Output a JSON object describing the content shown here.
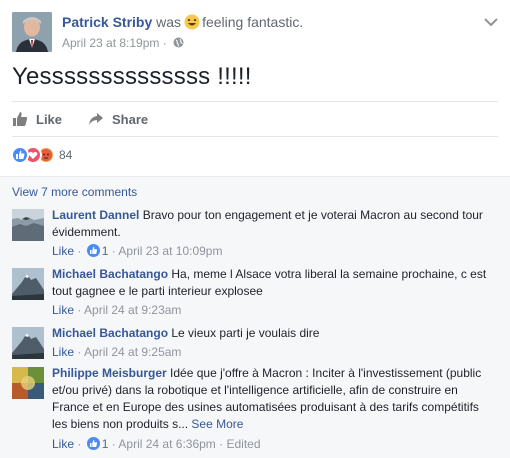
{
  "post": {
    "author": "Patrick Striby",
    "was": "was",
    "feeling": "feeling fantastic.",
    "date": "April 23 at 8:19pm",
    "dot": "·",
    "text": "Yessssssssssssss !!!!!"
  },
  "actions": {
    "like": "Like",
    "share": "Share"
  },
  "reactions": {
    "count": "84"
  },
  "view_more": "View 7 more comments",
  "comments": [
    {
      "name": "Laurent Dannel",
      "text": "Bravo pour ton engagement et je voterai Macron au second tour évidemment.",
      "like": "Like",
      "sep": "·",
      "likes": "1",
      "time": "April 23 at 10:09pm",
      "edited": ""
    },
    {
      "name": "Michael Bachatango",
      "text": "Ha, meme l Alsace votra liberal la semaine prochaine, c est tout gagnee e le parti interieur explosee",
      "like": "Like",
      "sep": "·",
      "time": "April 24 at 9:23am"
    },
    {
      "name": "Michael Bachatango",
      "text": "Le vieux parti je voulais dire",
      "like": "Like",
      "sep": "·",
      "time": "April 24 at 9:25am"
    },
    {
      "name": "Philippe Meisburger",
      "text": "Idée que j'offre à Macron : Inciter à l'investissement (public et/ou privé) dans la robotique et l'intelligence artificielle, afin de construire en France et en Europe des usines automatisées produisant à des tarifs compétitifs les biens non produits s...",
      "see_more": "See More",
      "like": "Like",
      "sep": "·",
      "likes": "1",
      "time": "April 24 at 6:36pm",
      "edited": "Edited"
    }
  ],
  "colors": {
    "link": "#365899",
    "meta": "#90949c",
    "like_blue": "#4c8bf5",
    "love_red": "#f25268",
    "angry_orange": "#f0a14b"
  }
}
